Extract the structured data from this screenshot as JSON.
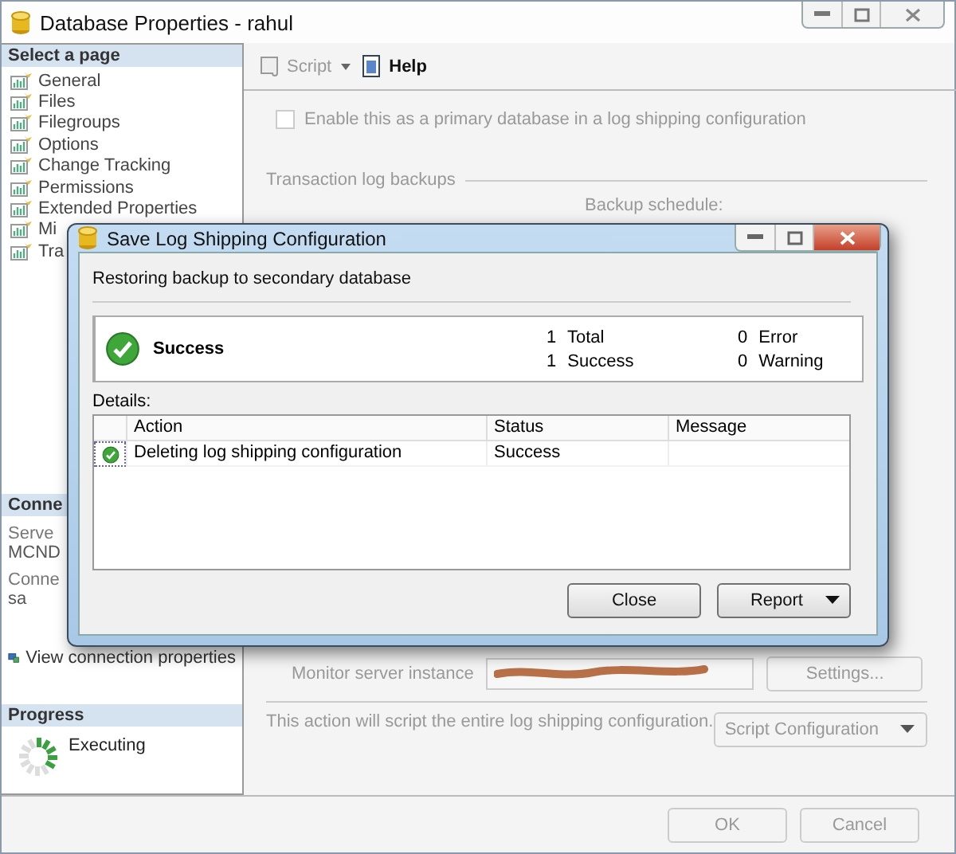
{
  "window": {
    "title": "Database Properties - rahul"
  },
  "sidebar": {
    "header": "Select a page",
    "pages": [
      {
        "label": "General"
      },
      {
        "label": "Files"
      },
      {
        "label": "Filegroups"
      },
      {
        "label": "Options"
      },
      {
        "label": "Change Tracking"
      },
      {
        "label": "Permissions"
      },
      {
        "label": "Extended Properties"
      },
      {
        "label": "Mi"
      },
      {
        "label": "Tra"
      }
    ]
  },
  "connection": {
    "header": "Conne",
    "server_label": "Serve",
    "server": "MCND",
    "connection_label": "Conne",
    "user": "sa",
    "link": "View connection properties"
  },
  "progress": {
    "header": "Progress",
    "status": "Executing"
  },
  "toolbar": {
    "script": "Script",
    "help": "Help"
  },
  "primary": {
    "label": "Enable this as a primary database in a log shipping configuration",
    "checked": false,
    "disabled": true
  },
  "backups": {
    "group": "Transaction log backups",
    "schedule_label": "Backup schedule:"
  },
  "monitor": {
    "label": "Monitor server instance",
    "settings": {
      "label": "Settings...",
      "disabled": true
    }
  },
  "note": "This action will script the entire log shipping configuration.",
  "script_configuration": {
    "label": "Script Configuration",
    "disabled": true
  },
  "footer": [
    {
      "label": "OK",
      "disabled": true
    },
    {
      "label": "Cancel",
      "disabled": true
    }
  ],
  "dialog": {
    "title": "Save Log Shipping Configuration",
    "message": "Restoring backup to secondary database",
    "summary": {
      "status": "Success",
      "counts": [
        "1 Total",
        "1 Success",
        "0 Error",
        "0 Warning"
      ]
    },
    "details_label": "Details:",
    "columns": [
      "Action",
      "Status",
      "Message"
    ],
    "rows": [
      {
        "action": "Deleting log shipping configuration",
        "status": "Success"
      }
    ],
    "buttons": [
      {
        "label": "Close",
        "kind": "plain"
      },
      {
        "label": "Report",
        "kind": "dropdown"
      }
    ]
  }
}
